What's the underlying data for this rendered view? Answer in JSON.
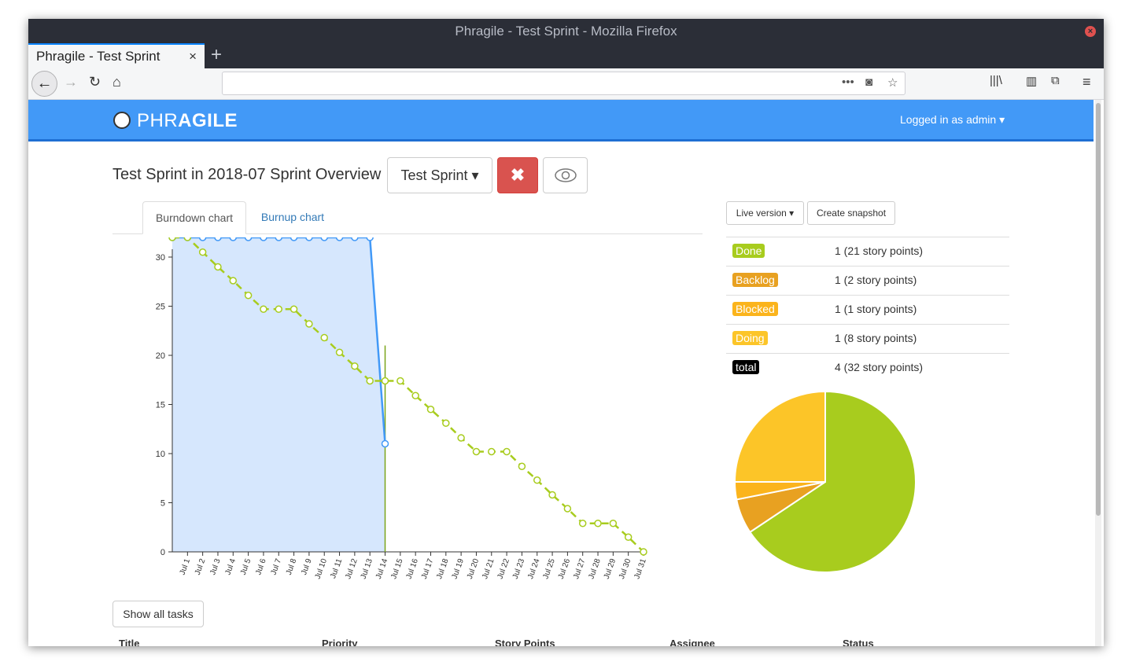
{
  "browser": {
    "window_title": "Phragile - Test Sprint - Mozilla Firefox",
    "tab_title": "Phragile - Test Sprint",
    "url": ""
  },
  "app": {
    "logo_light": "PHR",
    "logo_bold": "AGILE",
    "logged_in": "Logged in as admin"
  },
  "page": {
    "title": "Test Sprint in 2018-07 Sprint Overview",
    "sprint_select": "Test Sprint",
    "chart_tabs": [
      "Burndown chart",
      "Burnup chart"
    ],
    "show_tasks": "Show all tasks",
    "table_headers": [
      "Title",
      "Priority",
      "Story Points",
      "Assignee",
      "Status"
    ]
  },
  "snapshot": {
    "live_version": "Live version",
    "create_snapshot": "Create snapshot"
  },
  "status_summary": [
    {
      "label": "Done",
      "value": "1 (21 story points)",
      "color": "#a8cc1e"
    },
    {
      "label": "Backlog",
      "value": "1 (2 story points)",
      "color": "#e8a121"
    },
    {
      "label": "Blocked",
      "value": "1 (1 story points)",
      "color": "#fbb41c"
    },
    {
      "label": "Doing",
      "value": "1 (8 story points)",
      "color": "#fcc528"
    },
    {
      "label": "total",
      "value": "4 (32 story points)",
      "color": "#000000"
    }
  ],
  "chart_data": [
    {
      "type": "line",
      "title": "",
      "x": [
        "Jul 1",
        "Jul 2",
        "Jul 3",
        "Jul 4",
        "Jul 5",
        "Jul 6",
        "Jul 7",
        "Jul 8",
        "Jul 9",
        "Jul 10",
        "Jul 11",
        "Jul 12",
        "Jul 13",
        "Jul 14",
        "Jul 15",
        "Jul 16",
        "Jul 17",
        "Jul 18",
        "Jul 19",
        "Jul 20",
        "Jul 21",
        "Jul 22",
        "Jul 23",
        "Jul 24",
        "Jul 25",
        "Jul 26",
        "Jul 27",
        "Jul 28",
        "Jul 29",
        "Jul 30",
        "Jul 31"
      ],
      "ylim": [
        0,
        32
      ],
      "yticks": [
        0,
        5,
        10,
        15,
        20,
        25,
        30
      ],
      "series": [
        {
          "color": "#4299f7",
          "style": "solid",
          "filled": true,
          "x_start_index": -1,
          "values": [
            32,
            32,
            32,
            32,
            32,
            32,
            32,
            32,
            32,
            32,
            32,
            32,
            32,
            32,
            11
          ]
        },
        {
          "color": "#a8cc1e",
          "style": "dashed",
          "x_start_index": -1,
          "values": [
            32,
            32,
            30.5,
            29,
            27.6,
            26.1,
            24.7,
            24.7,
            24.7,
            23.2,
            21.8,
            20.3,
            18.9,
            17.4,
            17.4,
            17.4,
            15.9,
            14.5,
            13.1,
            11.6,
            10.2,
            10.2,
            10.2,
            8.7,
            7.3,
            5.8,
            4.4,
            2.9,
            2.9,
            2.9,
            1.5,
            0
          ]
        }
      ],
      "today_marker": {
        "x_index": 13,
        "value": 21,
        "color": "#7aa41a"
      }
    },
    {
      "type": "pie",
      "series": [
        {
          "name": "Done",
          "value": 21,
          "color": "#a8cc1e"
        },
        {
          "name": "Backlog",
          "value": 2,
          "color": "#e8a121"
        },
        {
          "name": "Blocked",
          "value": 1,
          "color": "#fbb41c"
        },
        {
          "name": "Doing",
          "value": 8,
          "color": "#fcc528"
        }
      ]
    }
  ]
}
